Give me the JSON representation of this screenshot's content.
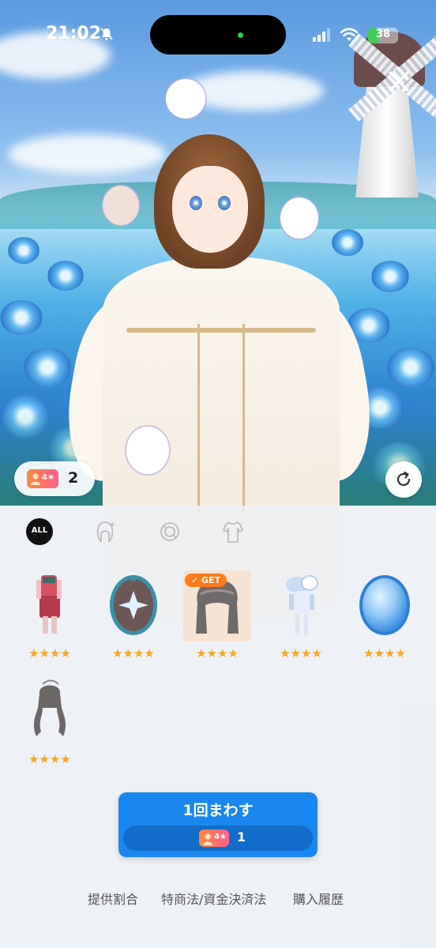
{
  "status_bar": {
    "time": "21:02",
    "battery": "38",
    "battery_level": 0.38
  },
  "banner": {
    "ticket_rarity": "4★",
    "ticket_count": "2"
  },
  "tabs": [
    {
      "label": "ALL",
      "icon": "all-icon",
      "selected": true
    },
    {
      "icon": "hair-icon"
    },
    {
      "icon": "accessory-ring-icon"
    },
    {
      "icon": "outfit-icon"
    }
  ],
  "items": [
    {
      "icon": "outfit-item-icon",
      "stars": "★★★★"
    },
    {
      "icon": "frame-badge-item-icon",
      "stars": "★★★★"
    },
    {
      "icon": "hairstyle-item-icon",
      "stars": "★★★★",
      "badge": "GET",
      "owned": true
    },
    {
      "icon": "costume-item-icon",
      "stars": "★★★★"
    },
    {
      "icon": "orb-item-icon",
      "stars": "★★★★"
    },
    {
      "icon": "long-hair-item-icon",
      "stars": "★★★★"
    }
  ],
  "spin": {
    "label": "1回まわす",
    "cost_rarity": "4★",
    "cost_count": "1"
  },
  "footer": {
    "rates": "提供割合",
    "law": "特商法/資金決済法",
    "history": "購入履歴"
  },
  "colors": {
    "accent": "#1a86f0",
    "star": "#f5a623",
    "get_badge": "#ff7a1a"
  }
}
